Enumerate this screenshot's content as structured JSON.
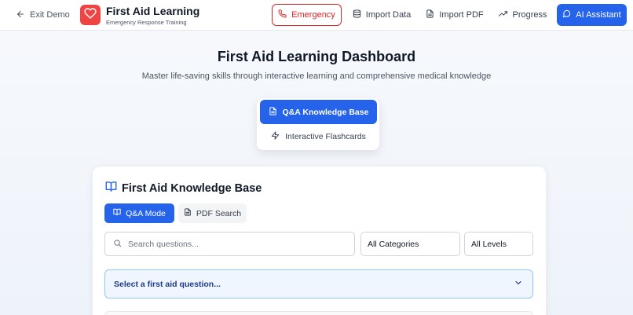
{
  "nav": {
    "exit_label": "Exit Demo",
    "brand_title": "First Aid Learning",
    "brand_subtitle": "Emergency Response Training",
    "emergency_label": "Emergency",
    "import_data_label": "Import Data",
    "import_pdf_label": "Import PDF",
    "progress_label": "Progress",
    "ai_label": "AI Assistant"
  },
  "hero": {
    "title": "First Aid Learning Dashboard",
    "subtitle": "Master life-saving skills through interactive learning and comprehensive medical knowledge"
  },
  "modes": {
    "qa_label": "Q&A Knowledge Base",
    "flashcards_label": "Interactive Flashcards",
    "active": "qa"
  },
  "knowledge_base": {
    "title": "First Aid Knowledge Base",
    "tabs": [
      {
        "label": "Q&A Mode",
        "active": true
      },
      {
        "label": "PDF Search",
        "active": false
      }
    ],
    "search": {
      "placeholder": "Search questions...",
      "value": ""
    },
    "category_select": "All Categories",
    "level_select": "All Levels",
    "question_select": "Select a first aid question..."
  },
  "colors": {
    "accent": "#2563eb",
    "emergency": "#dc2626",
    "brand_logo": "#ef4444"
  },
  "icons": {
    "exit": "arrow-left-icon",
    "logo": "heart-icon",
    "emergency": "phone-icon",
    "import_data": "database-icon",
    "import_pdf": "file-text-icon",
    "progress": "trending-up-icon",
    "ai": "message-circle-icon",
    "flashcards": "zap-icon",
    "kb": "book-open-icon",
    "search": "search-icon",
    "dropdown": "chevron-down-icon"
  }
}
